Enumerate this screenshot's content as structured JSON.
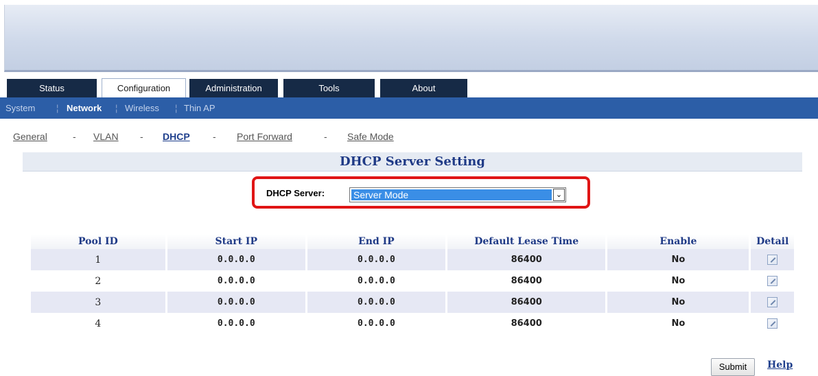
{
  "tabs": [
    {
      "label": "Status"
    },
    {
      "label": "Configuration"
    },
    {
      "label": "Administration"
    },
    {
      "label": "Tools"
    },
    {
      "label": "About"
    }
  ],
  "subnav": {
    "system": "System",
    "network": "Network",
    "wireless": "Wireless",
    "thin_ap": "Thin AP",
    "separator": "¦"
  },
  "crumbs": {
    "general": "General",
    "vlan": "VLAN",
    "dhcp": "DHCP",
    "port_forward": "Port Forward",
    "safe_mode": "Safe Mode",
    "dash": "-"
  },
  "section_title": "DHCP Server Setting",
  "dhcp_server": {
    "label": "DHCP Server:",
    "value": "Server Mode"
  },
  "table": {
    "headers": [
      "Pool ID",
      "Start IP",
      "End IP",
      "Default Lease Time",
      "Enable",
      "Detail"
    ],
    "rows": [
      {
        "pool_id": "1",
        "start_ip": "0.0.0.0",
        "end_ip": "0.0.0.0",
        "lease": "86400",
        "enable": "No"
      },
      {
        "pool_id": "2",
        "start_ip": "0.0.0.0",
        "end_ip": "0.0.0.0",
        "lease": "86400",
        "enable": "No"
      },
      {
        "pool_id": "3",
        "start_ip": "0.0.0.0",
        "end_ip": "0.0.0.0",
        "lease": "86400",
        "enable": "No"
      },
      {
        "pool_id": "4",
        "start_ip": "0.0.0.0",
        "end_ip": "0.0.0.0",
        "lease": "86400",
        "enable": "No"
      }
    ]
  },
  "actions": {
    "submit": "Submit",
    "help": "Help"
  },
  "colors": {
    "nav_dark": "#162a46",
    "subnav_blue": "#2c5ea7",
    "heading_blue": "#1f3a86",
    "highlight_red": "#e01515"
  }
}
